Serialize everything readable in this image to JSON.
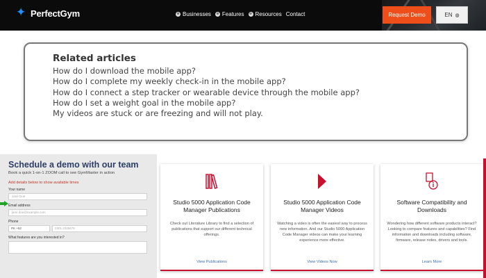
{
  "header": {
    "logo_text": "PerfectGym",
    "nav": [
      {
        "icon": "⊕",
        "label": "Businesses"
      },
      {
        "icon": "⊕",
        "label": "Features"
      },
      {
        "icon": "⊕",
        "label": "Resources"
      },
      {
        "icon": "",
        "label": "Contact"
      }
    ],
    "demo_button": "Request Demo",
    "language": "EN",
    "brand_color": "#ee4f1a"
  },
  "related": {
    "title": "Related articles",
    "articles": [
      "How do I download the mobile app?",
      "How do I complete my weekly check-in in the mobile app?",
      "How do I connect a step tracker or wearable device through the mobile app?",
      "How do I set a weight goal in the mobile app?",
      "My videos are stuck or are freezing and will not play."
    ]
  },
  "schedule": {
    "title": "Schedule a demo with our team",
    "subtitle": "Book a quick 1-on-1 ZOOM call to see GymMaster in action",
    "note": "Add details below to show available times",
    "name_label": "Your name",
    "name_placeholder": "Jane Doe",
    "email_label": "Email address",
    "email_placeholder": "jane.doe@example.com",
    "phone_label": "Phone",
    "phone_country": "PK +92",
    "phone_placeholder": "0301 2345678",
    "interest_label": "What features are you interested in?"
  },
  "cards": [
    {
      "icon": "books-icon",
      "title": "Studio 5000 Application Code Manager Publications",
      "text": "Check out Literature Library to find a selection of publications that support our different technical offerings.",
      "link": "View Publications"
    },
    {
      "icon": "play-icon",
      "title": "Studio 5000 Application Code Manager Videos",
      "text": "Watching a video is often the easiest way to process new information. And our Studio 5000 Application Code Manager videos can make your learning experience more effective.",
      "link": "View Videos Now"
    },
    {
      "icon": "device-info-icon",
      "title": "Software Compatibility and Downloads",
      "text": "Wondering how different software products interact? Looking to compare features and capabilities? Find information and downloads including software, firmware, release notes, drivers and tools.",
      "link": "Learn More"
    }
  ],
  "accent_color": "#c8102e"
}
